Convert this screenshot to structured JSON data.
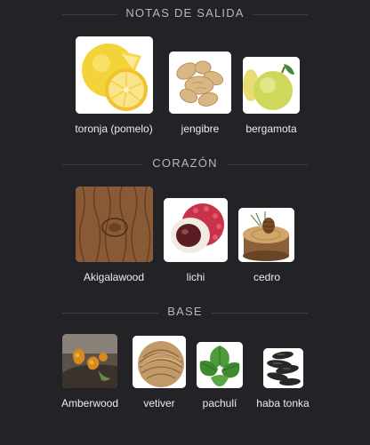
{
  "sections": [
    {
      "title": "NOTAS DE SALIDA",
      "notes": [
        {
          "label": "toronja (pomelo)",
          "icon": "grapefruit-icon"
        },
        {
          "label": "jengibre",
          "icon": "ginger-icon"
        },
        {
          "label": "bergamota",
          "icon": "bergamot-icon"
        }
      ]
    },
    {
      "title": "CORAZÓN",
      "notes": [
        {
          "label": "Akigalawood",
          "icon": "wood-grain-icon"
        },
        {
          "label": "lichi",
          "icon": "lychee-icon"
        },
        {
          "label": "cedro",
          "icon": "cedar-stump-icon"
        }
      ]
    },
    {
      "title": "BASE",
      "notes": [
        {
          "label": "Amberwood",
          "icon": "amber-resin-icon"
        },
        {
          "label": "vetiver",
          "icon": "vetiver-root-icon"
        },
        {
          "label": "pachulí",
          "icon": "patchouli-leaf-icon"
        },
        {
          "label": "haba tonka",
          "icon": "tonka-bean-icon"
        }
      ]
    }
  ]
}
